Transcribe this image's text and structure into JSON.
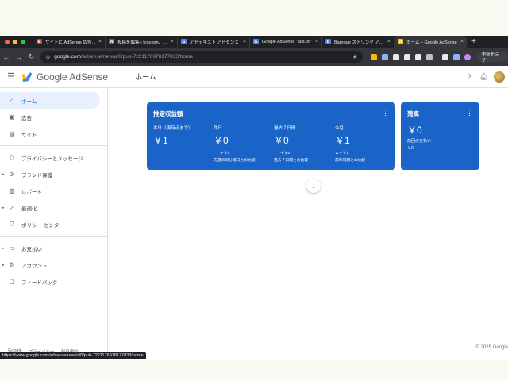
{
  "browser": {
    "tabs": [
      {
        "title": "サイトに AdSense 広告を表示",
        "favicon": "gmail-icon",
        "color": "#d93025",
        "glyph": "M"
      },
      {
        "title": "投稿を編集 ‹ [cocoon、ad...",
        "favicon": "wordpress-icon",
        "color": "#5f6368",
        "glyph": "W"
      },
      {
        "title": "アドテキスト アドセンス",
        "favicon": "google-icon",
        "color": "#4285f4",
        "glyph": "G"
      },
      {
        "title": "Google AdSense \"ads.txt\"",
        "favicon": "google-icon",
        "color": "#4285f4",
        "glyph": "G"
      },
      {
        "title": "Baroque ストリング アクセ...",
        "favicon": "bookmark-icon",
        "color": "#4a7bdc",
        "glyph": "B"
      },
      {
        "title": "ホーム – Google AdSense",
        "favicon": "adsense-icon",
        "color": "#fbbc04",
        "glyph": "A",
        "active": true
      }
    ],
    "url_domain": "google.com",
    "url_path": "/adsense/new/u/0/pub-7221176978177833/home",
    "update_label": "更新を完了"
  },
  "header": {
    "app_name": "Google AdSense",
    "page_title": "ホーム"
  },
  "sidebar": {
    "items": [
      {
        "label": "ホーム",
        "icon": "home-icon",
        "active": true
      },
      {
        "label": "広告",
        "icon": "ads-icon"
      },
      {
        "label": "サイト",
        "icon": "sites-icon"
      },
      {
        "label": "プライバシーとメッセージ",
        "icon": "privacy-icon"
      },
      {
        "label": "ブランド保護",
        "icon": "block-icon",
        "caret": true
      },
      {
        "label": "レポート",
        "icon": "reports-icon"
      },
      {
        "label": "最適化",
        "icon": "trend-icon",
        "caret": true
      },
      {
        "label": "ポリシー センター",
        "icon": "shield-icon"
      },
      {
        "label": "お支払い",
        "icon": "payments-icon",
        "caret": true
      },
      {
        "label": "アカウント",
        "icon": "gear-icon",
        "caret": true
      },
      {
        "label": "フィードバック",
        "icon": "feedback-icon"
      }
    ],
    "footer": [
      "Google",
      "プライバシー",
      "利用規約"
    ]
  },
  "earnings_card": {
    "title": "推定収益額",
    "metrics": [
      {
        "label": "本日（現時点まで）",
        "value": "￥1",
        "delta": "",
        "compare": ""
      },
      {
        "label": "昨日",
        "value": "￥0",
        "delta": "＋￥0",
        "compare": "先週の同じ曜日との比較"
      },
      {
        "label": "過去７日間",
        "value": "￥0",
        "delta": "＋￥0",
        "compare": "過去７日間との比較"
      },
      {
        "label": "今月",
        "value": "￥1",
        "delta": "▲＋￥1",
        "compare": "前年同期との比較"
      }
    ]
  },
  "balance_card": {
    "title": "残高",
    "value": "￥0",
    "label": "前回の支払い",
    "sub": "￥0"
  },
  "footer": {
    "copyright": "© 2025 Google"
  },
  "status_url": "https://www.google.com/adsense/new/u/0/pub-7221176978177833/home",
  "colors": {
    "card": "#1a64c7",
    "accent": "#1967d2"
  }
}
